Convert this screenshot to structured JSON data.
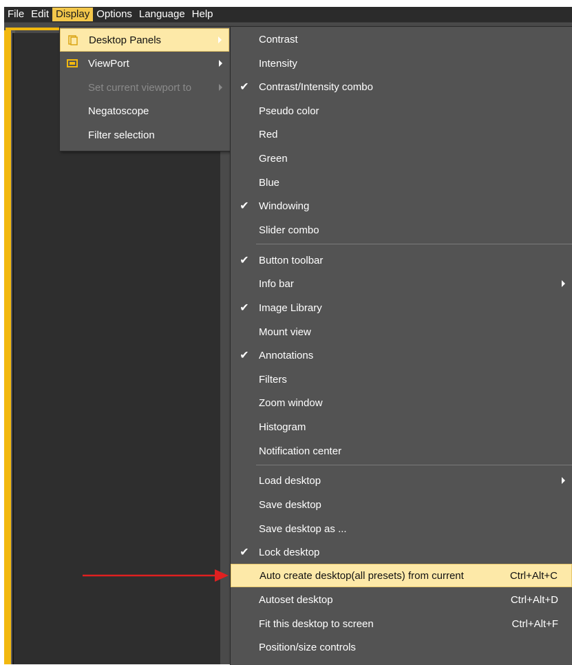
{
  "menubar": {
    "items": [
      "File",
      "Edit",
      "Display",
      "Options",
      "Language",
      "Help"
    ],
    "active": "Display"
  },
  "display_menu": {
    "items": [
      {
        "label": "Desktop Panels",
        "icon": "panels-icon",
        "submenu": true,
        "highlighted": true
      },
      {
        "label": "ViewPort",
        "icon": "viewport-icon",
        "submenu": true
      },
      {
        "label": "Set current viewport to",
        "submenu": true,
        "disabled": true
      },
      {
        "label": "Negatoscope"
      },
      {
        "label": "Filter selection"
      }
    ]
  },
  "panels_menu": {
    "group1": [
      {
        "label": "Contrast",
        "checked": false
      },
      {
        "label": "Intensity",
        "checked": false
      },
      {
        "label": "Contrast/Intensity combo",
        "checked": true
      },
      {
        "label": "Pseudo color",
        "checked": false
      },
      {
        "label": "Red",
        "checked": false
      },
      {
        "label": "Green",
        "checked": false
      },
      {
        "label": "Blue",
        "checked": false
      },
      {
        "label": "Windowing",
        "checked": true
      },
      {
        "label": "Slider combo",
        "checked": false
      }
    ],
    "group2": [
      {
        "label": "Button toolbar",
        "checked": true
      },
      {
        "label": "Info bar",
        "checked": false,
        "submenu": true
      },
      {
        "label": "Image Library",
        "checked": true
      },
      {
        "label": "Mount view",
        "checked": false
      },
      {
        "label": "Annotations",
        "checked": true
      },
      {
        "label": "Filters",
        "checked": false
      },
      {
        "label": "Zoom window",
        "checked": false
      },
      {
        "label": "Histogram",
        "checked": false
      },
      {
        "label": "Notification center",
        "checked": false
      }
    ],
    "group3": [
      {
        "label": "Load desktop",
        "checked": false,
        "submenu": true
      },
      {
        "label": "Save desktop",
        "checked": false
      },
      {
        "label": "Save desktop as ...",
        "checked": false
      },
      {
        "label": "Lock desktop",
        "checked": true
      },
      {
        "label": "Auto create desktop(all presets) from current",
        "shortcut": "Ctrl+Alt+C",
        "highlighted": true
      },
      {
        "label": "Autoset desktop",
        "shortcut": "Ctrl+Alt+D"
      },
      {
        "label": "Fit this desktop to screen",
        "shortcut": "Ctrl+Alt+F"
      },
      {
        "label": "Position/size controls"
      }
    ]
  },
  "colors": {
    "accent": "#f2b80f",
    "highlight": "#fde9a8",
    "menu_bg": "#535353",
    "arrow": "#e02020"
  },
  "check_glyph": "✔"
}
